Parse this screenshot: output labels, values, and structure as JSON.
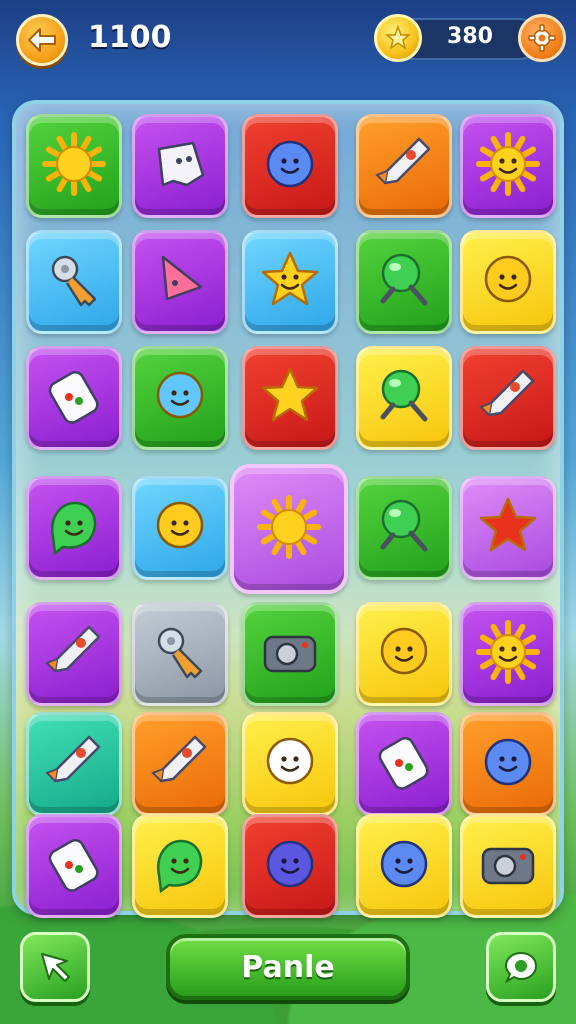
{
  "hud": {
    "score": "1100",
    "coins": "380",
    "back_icon": "arrow-left-icon",
    "coin_icon": "star-coin-icon",
    "settings_icon": "gear-icon"
  },
  "board": {
    "rows": [
      [
        {
          "icon": "sun-icon",
          "color": "green"
        },
        {
          "icon": "ghost-icon",
          "color": "purple"
        },
        {
          "icon": "blue-monster-icon",
          "color": "red"
        },
        {
          "icon": "rocket-icon",
          "color": "orange"
        },
        {
          "icon": "smiling-flower-icon",
          "color": "purple"
        }
      ],
      [
        {
          "icon": "key-icon",
          "color": "lightblue"
        },
        {
          "icon": "flag-icon",
          "color": "purple"
        },
        {
          "icon": "yellow-star-creature-icon",
          "color": "lightblue"
        },
        {
          "icon": "pin-icon",
          "color": "green"
        },
        {
          "icon": "smiley-balloon-icon",
          "color": "yellow"
        }
      ],
      [
        {
          "icon": "card-icon",
          "color": "purple"
        },
        {
          "icon": "balloon-face-icon",
          "color": "green"
        },
        {
          "icon": "star-icon",
          "color": "red"
        },
        {
          "icon": "magnifier-orb-icon",
          "color": "yellow"
        },
        {
          "icon": "rocket-icon",
          "color": "red"
        }
      ],
      [
        {
          "icon": "green-blob-icon",
          "color": "purple"
        },
        {
          "icon": "smiley-icon",
          "color": "lightblue"
        },
        {
          "icon": "sun-icon",
          "color": "violet",
          "selected": true
        },
        {
          "icon": "pin-icon",
          "color": "green"
        },
        {
          "icon": "red-star-icon",
          "color": "violet"
        }
      ],
      [
        {
          "icon": "rocket-icon",
          "color": "purple"
        },
        {
          "icon": "key-icon",
          "color": "gray"
        },
        {
          "icon": "camera-icon",
          "color": "green"
        },
        {
          "icon": "smiley-icon",
          "color": "yellow"
        },
        {
          "icon": "smiling-sun-icon",
          "color": "purple"
        }
      ],
      [
        {
          "icon": "cone-icon",
          "color": "teal"
        },
        {
          "icon": "ufo-icon",
          "color": "orange"
        },
        {
          "icon": "happy-ghost-icon",
          "color": "yellow"
        },
        {
          "icon": "card-icon",
          "color": "purple"
        },
        {
          "icon": "blue-gear-face-icon",
          "color": "orange"
        }
      ],
      [
        {
          "icon": "bottle-icon",
          "color": "purple"
        },
        {
          "icon": "green-blob-icon",
          "color": "yellow"
        },
        {
          "icon": "purple-ball-icon",
          "color": "red"
        },
        {
          "icon": "green-balloon-icon",
          "color": "yellow"
        },
        {
          "icon": "camera-icon",
          "color": "yellow"
        }
      ]
    ]
  },
  "footer": {
    "left_icon": "arrow-up-left-icon",
    "main_label": "Panle",
    "right_icon": "chat-bubble-icon"
  }
}
